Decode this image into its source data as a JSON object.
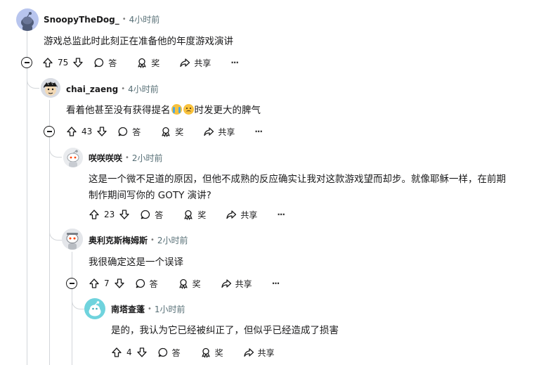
{
  "comments": [
    {
      "author": "SnoopyTheDog_",
      "separator": "•",
      "time": "4小时前",
      "body": "游戏总监此时此刻正在准备他的年度游戏演讲",
      "votes": "75",
      "reply_label": "答",
      "award_label": "奖",
      "share_label": "共享",
      "more": "···"
    },
    {
      "author": "chai_zaeng",
      "separator": "•",
      "time": "4小时前",
      "body_before": "看着他甚至没有获得提名",
      "body_after": "时发更大的脾气",
      "emoji": [
        "loudly-crying-face",
        "sad-face"
      ],
      "votes": "43",
      "reply_label": "答",
      "award_label": "奖",
      "share_label": "共享",
      "more": "···"
    },
    {
      "author": "咲咲咲咲",
      "separator": "•",
      "time": "2小时前",
      "body_line1": "这是一个微不足道的原因，但他不成熟的反应确实让我对这款游戏望而却步。就像耶稣一样，在前期",
      "body_line2": "制作期间写你的 GOTY 演讲?",
      "votes": "23",
      "reply_label": "答",
      "award_label": "奖",
      "share_label": "共享",
      "more": "···"
    },
    {
      "author": "奥利克斯梅姆斯",
      "separator": "•",
      "time": "2小时前",
      "body": "我很确定这是一个误译",
      "votes": "7",
      "reply_label": "答",
      "award_label": "奖",
      "share_label": "共享",
      "more": "···"
    },
    {
      "author": "南塔查蓬",
      "separator": "•",
      "time": "1小时前",
      "body": "是的，我认为它已经被纠正了，但似乎已经造成了损害",
      "votes": "4",
      "reply_label": "答",
      "award_label": "奖",
      "share_label": "共享"
    }
  ],
  "colors": {
    "text": "#1a1a1b",
    "meta": "#576f76",
    "thread_line": "#d3d6da",
    "avatar_snoo_blue": "#b8c5ee",
    "avatar_teal": "#6fd3dd"
  },
  "icons": {
    "upvote": "upvote-arrow-icon",
    "downvote": "downvote-arrow-icon",
    "reply": "comment-bubble-icon",
    "award": "award-ribbon-icon",
    "share": "share-arrow-icon",
    "collapse": "collapse-minus-icon",
    "more": "more-options-icon"
  }
}
